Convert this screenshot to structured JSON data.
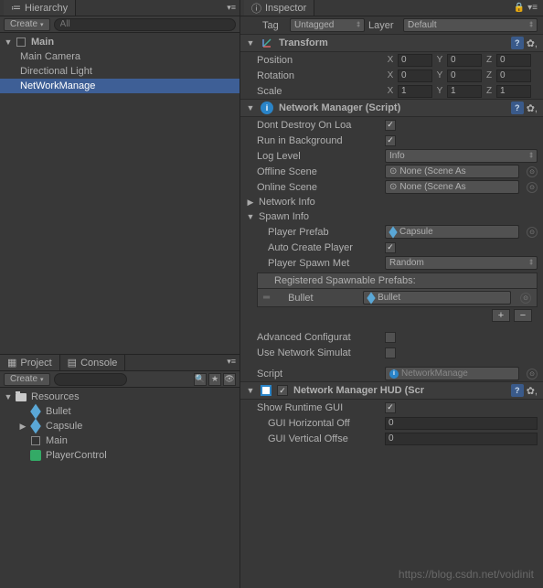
{
  "hierarchy": {
    "tab_label": "Hierarchy",
    "create_label": "Create",
    "search_placeholder": "All",
    "root": "Main",
    "items": [
      "Main Camera",
      "Directional Light",
      "NetWorkManage"
    ],
    "selected_index": 2
  },
  "project": {
    "tab_project": "Project",
    "tab_console": "Console",
    "create_label": "Create",
    "root": "Resources",
    "items": [
      {
        "name": "Bullet",
        "icon": "cube"
      },
      {
        "name": "Capsule",
        "icon": "cube"
      },
      {
        "name": "Main",
        "icon": "unity"
      },
      {
        "name": "PlayerControl",
        "icon": "cs"
      }
    ]
  },
  "inspector": {
    "tab_label": "Inspector",
    "tag_label": "Tag",
    "tag_value": "Untagged",
    "layer_label": "Layer",
    "layer_value": "Default",
    "transform": {
      "title": "Transform",
      "position_label": "Position",
      "rotation_label": "Rotation",
      "scale_label": "Scale",
      "pos": {
        "x": "0",
        "y": "0",
        "z": "0"
      },
      "rot": {
        "x": "0",
        "y": "0",
        "z": "0"
      },
      "scl": {
        "x": "1",
        "y": "1",
        "z": "1"
      }
    },
    "netmgr": {
      "title": "Network Manager (Script)",
      "dont_destroy_label": "Dont Destroy On Loa",
      "run_bg_label": "Run in Background",
      "log_level_label": "Log Level",
      "log_level_value": "Info",
      "offline_label": "Offline Scene",
      "offline_value": "None (Scene As",
      "online_label": "Online Scene",
      "online_value": "None (Scene As",
      "network_info": "Network Info",
      "spawn_info": "Spawn Info",
      "player_prefab_label": "Player Prefab",
      "player_prefab_value": "Capsule",
      "auto_create_label": "Auto Create Player",
      "spawn_method_label": "Player Spawn Met",
      "spawn_method_value": "Random",
      "reg_prefabs_label": "Registered Spawnable Prefabs:",
      "reg_item_label": "Bullet",
      "reg_item_value": "Bullet",
      "adv_config_label": "Advanced Configurat",
      "use_sim_label": "Use Network Simulat",
      "script_label": "Script",
      "script_value": "NetworkManage"
    },
    "hud": {
      "title": "Network Manager HUD (Scr",
      "show_gui_label": "Show Runtime GUI",
      "h_offset_label": "GUI Horizontal Off",
      "h_offset_value": "0",
      "v_offset_label": "GUI Vertical Offse",
      "v_offset_value": "0"
    }
  },
  "watermark": "https://blog.csdn.net/voidinit"
}
